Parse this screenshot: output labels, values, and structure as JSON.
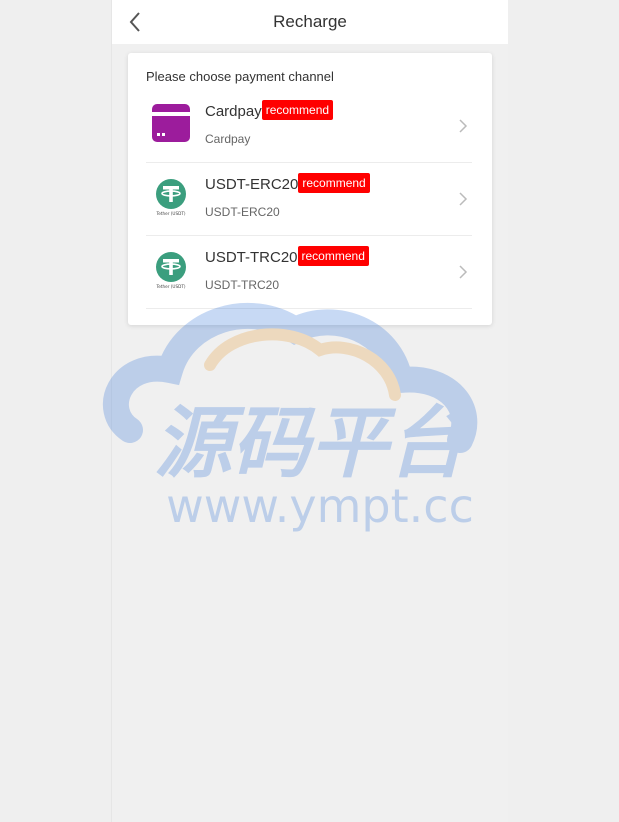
{
  "header": {
    "title": "Recharge",
    "back_icon": "chevron-left-icon"
  },
  "card": {
    "title": "Please choose payment channel"
  },
  "channels": [
    {
      "name": "Cardpay",
      "badge": "recommend",
      "subtitle": "Cardpay",
      "icon": "card-icon",
      "icon_color": "#9c1c9c"
    },
    {
      "name": "USDT-ERC20",
      "badge": "recommend",
      "subtitle": "USDT-ERC20",
      "icon": "tether-icon",
      "icon_label": "Tether (USDT)",
      "icon_color": "#3b9e7e"
    },
    {
      "name": "USDT-TRC20",
      "badge": "recommend",
      "subtitle": "USDT-TRC20",
      "icon": "tether-icon",
      "icon_label": "Tether (USDT)",
      "icon_color": "#3b9e7e"
    }
  ],
  "colors": {
    "badge": "#ff0000",
    "background": "#f0f0f0"
  },
  "watermark": {
    "title": "源码平台",
    "url": "www.ympt.cc"
  }
}
